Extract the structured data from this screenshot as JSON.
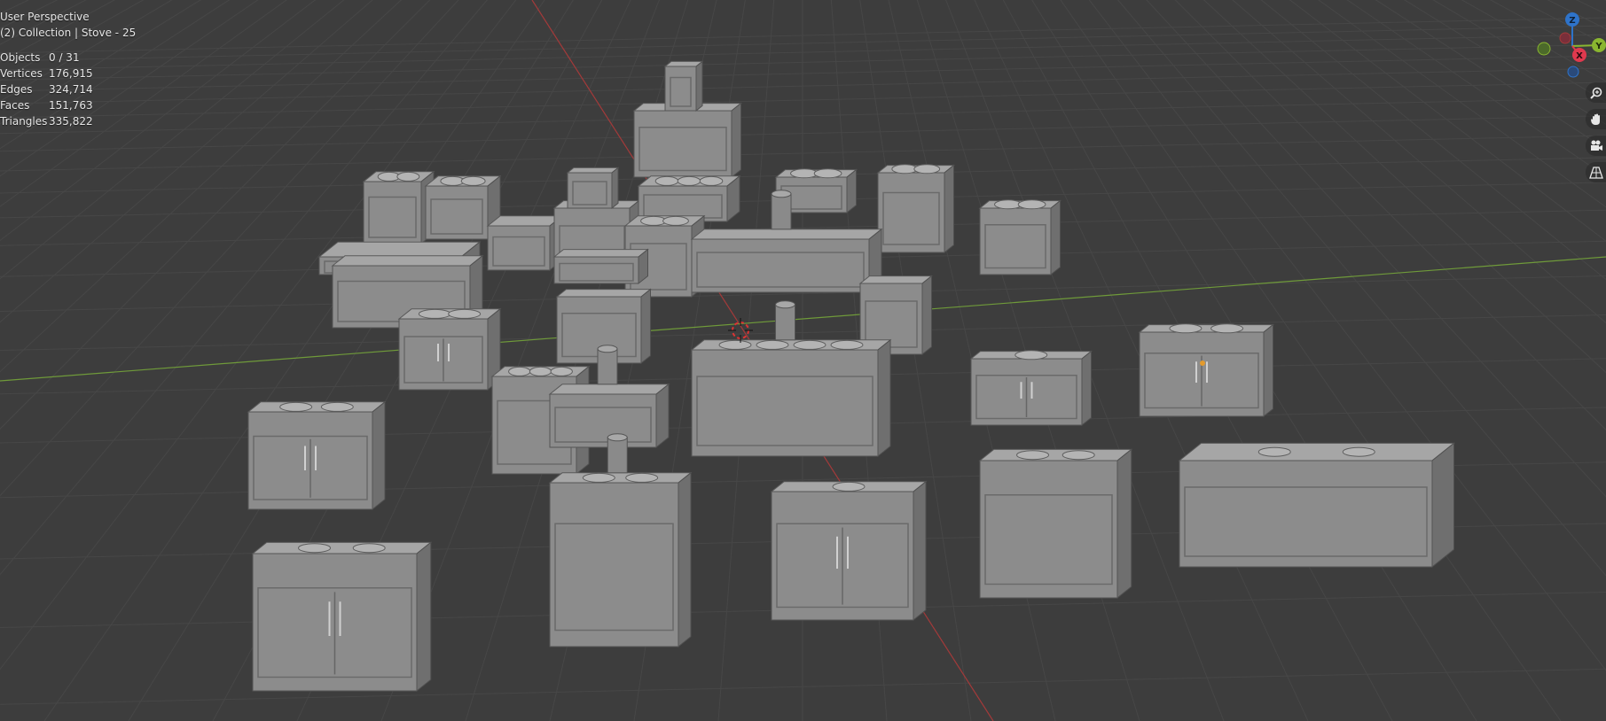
{
  "viewport": {
    "view_name": "User Perspective",
    "collection_info": "(2) Collection | Stove - 25"
  },
  "stats": [
    {
      "label": "Objects",
      "value": "0 / 31"
    },
    {
      "label": "Vertices",
      "value": "176,915"
    },
    {
      "label": "Edges",
      "value": "324,714"
    },
    {
      "label": "Faces",
      "value": "151,763"
    },
    {
      "label": "Triangles",
      "value": "335,822"
    }
  ],
  "gizmo": {
    "z": "Z",
    "y": "Y",
    "x": "X"
  },
  "nav_tools": [
    {
      "icon": "zoom-icon"
    },
    {
      "icon": "hand-pan-icon"
    },
    {
      "icon": "camera-icon"
    },
    {
      "icon": "perspective-grid-icon"
    }
  ],
  "colors": {
    "background": "#3d3d3d",
    "grid_line": "#484848",
    "x_axis": "#a33a3a",
    "y_axis": "#6f9a3a",
    "object": "#8c8c8c",
    "gizmo_x": "#e0394e",
    "gizmo_y": "#8ab630",
    "gizmo_z": "#2e73c9"
  }
}
